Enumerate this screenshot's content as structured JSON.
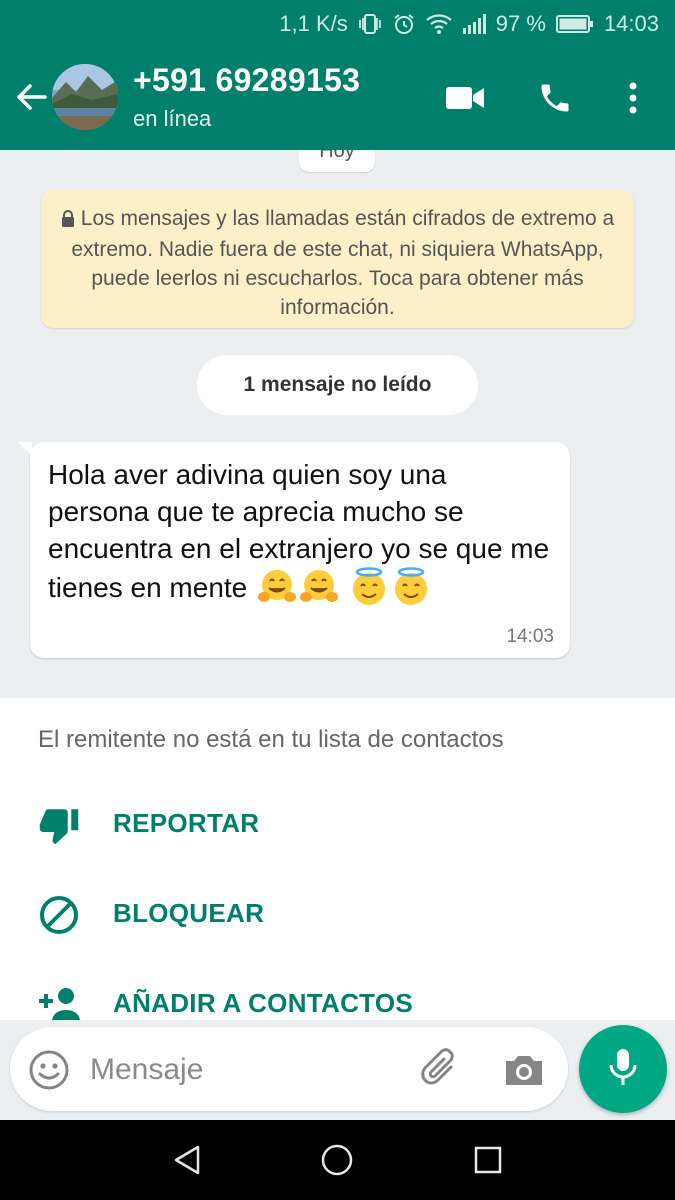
{
  "status_bar": {
    "net_speed": "1,1 K/s",
    "battery": "97 %",
    "time": "14:03",
    "icons": [
      "vibrate-icon",
      "alarm-icon",
      "wifi-icon",
      "signal-icon",
      "battery-icon"
    ]
  },
  "header": {
    "contact": "+591 69289153",
    "status": "en línea",
    "icons": [
      "back-arrow-icon",
      "video-call-icon",
      "phone-icon",
      "more-vert-icon"
    ]
  },
  "chat": {
    "date_chip": "Hoy",
    "encryption_notice": "Los mensajes y las llamadas están cifrados de extremo a extremo. Nadie fuera de este chat, ni siquiera WhatsApp, puede leerlos ni escucharlos. Toca para obtener más información.",
    "unread_chip": "1 mensaje no leído",
    "message": {
      "text": "Hola aver adivina quien soy una persona que te aprecia mucho se encuentra en el extranjero yo se que me tienes en mente",
      "emojis": [
        "hugging-face",
        "hugging-face",
        "smiling-face-with-halo",
        "smiling-face-with-halo"
      ],
      "time": "14:03"
    }
  },
  "unknown_sender": {
    "title": "El remitente no está en tu lista de contactos",
    "actions": [
      {
        "label": "REPORTAR",
        "icon": "thumbs-down-icon"
      },
      {
        "label": "BLOQUEAR",
        "icon": "block-icon"
      },
      {
        "label": "AÑADIR A CONTACTOS",
        "icon": "add-person-icon"
      }
    ]
  },
  "composer": {
    "placeholder": "Mensaje",
    "icons": [
      "emoji-icon",
      "attach-icon",
      "camera-icon",
      "mic-icon"
    ]
  },
  "nav": {
    "icons": [
      "back-triangle-icon",
      "home-circle-icon",
      "recents-square-icon"
    ]
  },
  "colors": {
    "primary": "#00806a",
    "accent": "#00a884",
    "notice_bg": "#fbf0c8",
    "chat_bg": "#eceff1"
  }
}
